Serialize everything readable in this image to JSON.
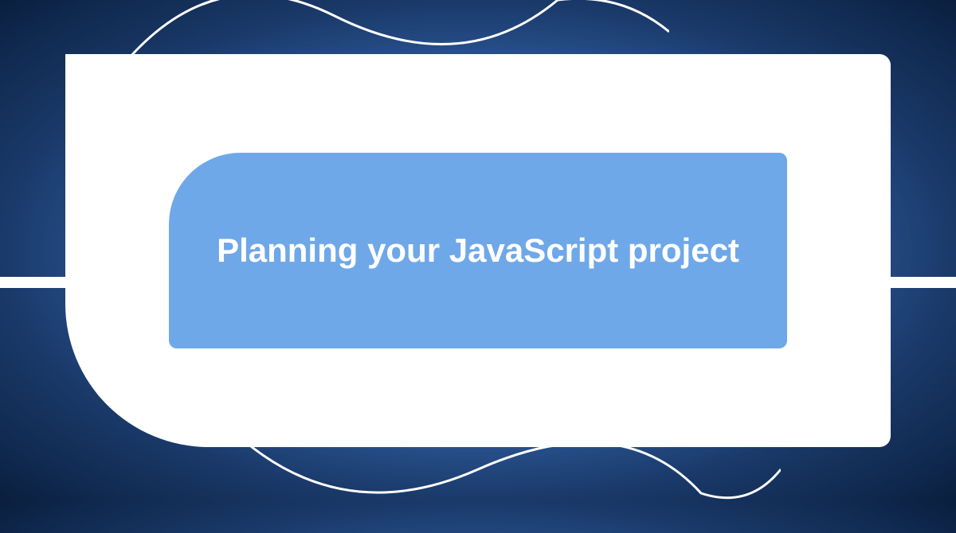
{
  "title": "Planning your JavaScript project",
  "colors": {
    "background_center": "#5a9de8",
    "background_edge": "#0a1f3f",
    "outer_shape": "#ffffff",
    "inner_shape": "#6fa8e8",
    "text": "#ffffff",
    "wave_stroke": "#ffffff"
  }
}
